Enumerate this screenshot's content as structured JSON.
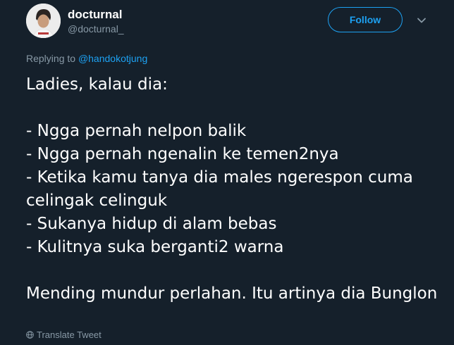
{
  "author": {
    "display_name": "docturnal",
    "handle": "@docturnal_",
    "avatar": "avatar-photo"
  },
  "header": {
    "follow_label": "Follow",
    "menu_icon": "chevron-down-icon"
  },
  "reply": {
    "prefix": "Replying to",
    "mention": "@handokotjung"
  },
  "tweet": {
    "text": "Ladies, kalau dia:\n\n- Ngga pernah nelpon balik\n- Ngga pernah ngenalin ke temen2nya\n- Ketika kamu tanya dia males ngerespon cuma celingak celinguk\n- Sukanya hidup di alam bebas\n- Kulitnya suka berganti2 warna\n\nMending mundur perlahan. Itu artinya dia Bunglon"
  },
  "footer": {
    "translate_label": "Translate Tweet",
    "translate_icon": "globe-icon"
  },
  "colors": {
    "background": "#15202b",
    "text": "#ffffff",
    "secondary_text": "#8899a6",
    "accent": "#1da1f2"
  }
}
